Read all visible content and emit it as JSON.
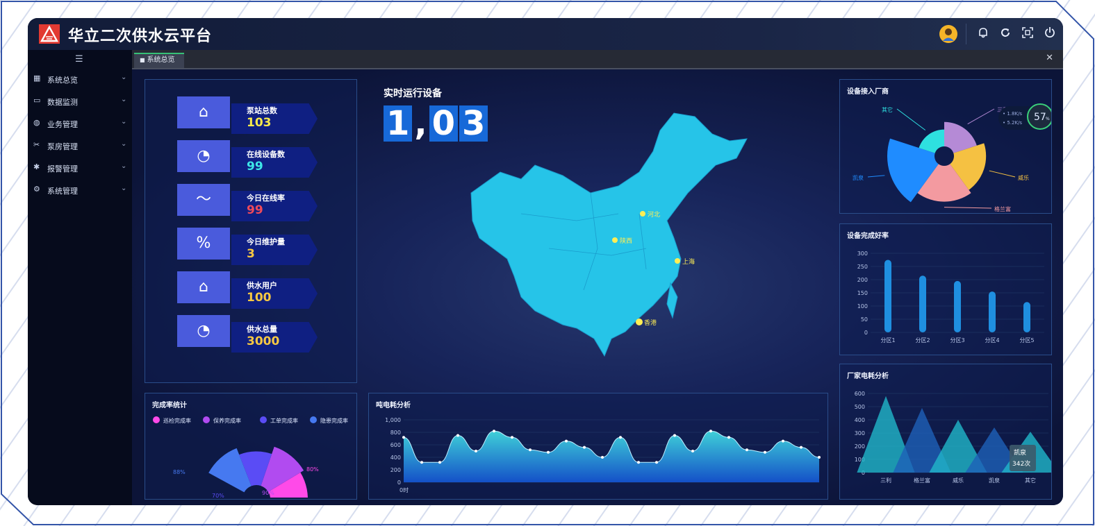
{
  "app": {
    "title": "华立二次供水云平台"
  },
  "sidebar": {
    "toggle_icon": "menu-icon",
    "items": [
      {
        "label": "系统总览",
        "icon": "map-icon"
      },
      {
        "label": "数据监测",
        "icon": "monitor-icon"
      },
      {
        "label": "业务管理",
        "icon": "globe-icon"
      },
      {
        "label": "泵房管理",
        "icon": "tools-icon"
      },
      {
        "label": "报警管理",
        "icon": "alarm-icon"
      },
      {
        "label": "系统管理",
        "icon": "gear-icon"
      }
    ]
  },
  "tabs": [
    {
      "label": "系统总览"
    }
  ],
  "stats": [
    {
      "label": "泵站总数",
      "value": "103",
      "color": "#f7e94b",
      "icon": "home-icon"
    },
    {
      "label": "在线设备数",
      "value": "99",
      "color": "#3ee6e8",
      "icon": "chart-clock-icon"
    },
    {
      "label": "今日在线率",
      "value": "99",
      "color": "#f04a5a",
      "icon": "pulse-icon"
    },
    {
      "label": "今日维护量",
      "value": "3",
      "color": "#f7c843",
      "icon": "percent-gauge-icon"
    },
    {
      "label": "供水用户",
      "value": "100",
      "color": "#f7c843",
      "icon": "home-icon"
    },
    {
      "label": "供水总量",
      "value": "3000",
      "color": "#f7c843",
      "icon": "chart-clock-icon"
    }
  ],
  "realtime": {
    "title": "实时运行设备",
    "digits": [
      "1",
      ",",
      "0",
      "3"
    ]
  },
  "map": {
    "labels": [
      "河北",
      "陕西",
      "上海",
      "香港"
    ]
  },
  "chart_data": [
    {
      "id": "vendor",
      "type": "pie",
      "title": "设备接入厂商",
      "categories": [
        "三利",
        "威乐",
        "格兰富",
        "凯泉",
        "其它"
      ],
      "values": [
        25,
        35,
        40,
        55,
        15
      ],
      "colors": [
        "#b58ad6",
        "#f5c142",
        "#f39aa0",
        "#1f8cff",
        "#2ee0e0"
      ],
      "gauge": {
        "percent": "57",
        "unit": "%",
        "up": "1.8K/s",
        "down": "5.2K/s"
      }
    },
    {
      "id": "intact",
      "type": "bar",
      "title": "设备完成好率",
      "categories": [
        "分区1",
        "分区2",
        "分区3",
        "分区4",
        "分区5"
      ],
      "values": [
        275,
        215,
        195,
        155,
        115
      ],
      "ylim": [
        0,
        300
      ],
      "yticks": [
        "0",
        "50",
        "100",
        "150",
        "200",
        "250",
        "300"
      ]
    },
    {
      "id": "energy",
      "type": "bar",
      "title": "厂家电耗分析",
      "categories": [
        "三利",
        "格兰富",
        "威乐",
        "凯泉",
        "其它"
      ],
      "values": [
        580,
        490,
        400,
        342,
        310
      ],
      "ylim": [
        0,
        600
      ],
      "yticks": [
        "0",
        "100",
        "200",
        "300",
        "400",
        "500",
        "600"
      ],
      "tooltip": {
        "name": "凯泉",
        "value": "342次"
      }
    },
    {
      "id": "completion",
      "type": "pie",
      "title": "完成率统计",
      "legend": [
        "巡检完成率",
        "保养完成率",
        "工单完成率",
        "隐患完成率"
      ],
      "legend_colors": [
        "#ff4ae8",
        "#b14bf0",
        "#5a4cf5",
        "#4679f0"
      ],
      "values": [
        80,
        90,
        70,
        88
      ],
      "labels": [
        "80%",
        "90%",
        "70%",
        "88%"
      ]
    },
    {
      "id": "ton",
      "type": "area",
      "title": "吨电耗分析",
      "ylim": [
        0,
        1000
      ],
      "yticks": [
        "0",
        "200",
        "400",
        "600",
        "800",
        "1,000"
      ],
      "xtick": "0时",
      "values": [
        720,
        320,
        320,
        750,
        500,
        820,
        720,
        520,
        480,
        660,
        560,
        400,
        720,
        320,
        320,
        750,
        500,
        820,
        720,
        520,
        480,
        660,
        560,
        400
      ]
    }
  ]
}
